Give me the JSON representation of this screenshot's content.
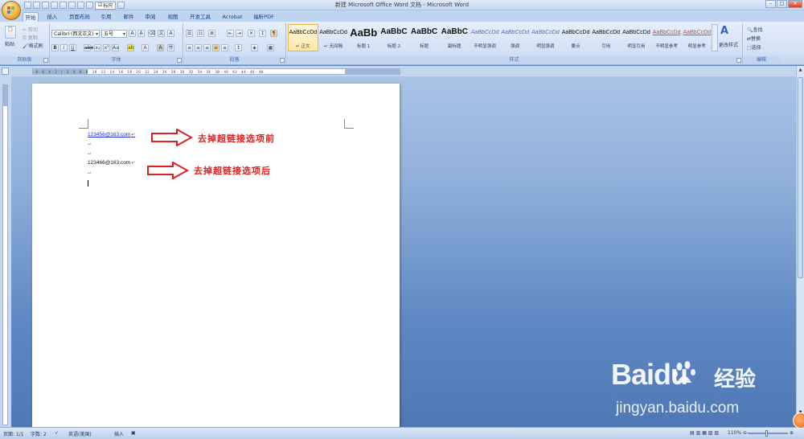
{
  "window": {
    "title": "新建 Microsoft Office Word 文档 - Microsoft Word",
    "ruler_toggle_label": "标尺"
  },
  "tabs": [
    "开始",
    "插入",
    "页面布局",
    "引用",
    "邮件",
    "审阅",
    "视图",
    "开发工具",
    "Acrobat",
    "福昕PDF"
  ],
  "clipboard": {
    "paste": "粘贴",
    "cut": "剪切",
    "copy": "复制",
    "format_painter": "格式刷",
    "group": "剪贴板"
  },
  "font": {
    "family": "Calibri (西文正文)",
    "size": "五号",
    "group": "字体"
  },
  "paragraph": {
    "group": "段落"
  },
  "styles": {
    "group": "样式",
    "items": [
      {
        "sample": "AaBbCcDd",
        "name": "↵ 正文"
      },
      {
        "sample": "AaBbCcDd",
        "name": "↵ 无间隔"
      },
      {
        "sample": "AaBb",
        "name": "标题 1"
      },
      {
        "sample": "AaBbC",
        "name": "标题 2"
      },
      {
        "sample": "AaBbC",
        "name": "标题"
      },
      {
        "sample": "AaBbC",
        "name": "副标题"
      },
      {
        "sample": "AaBbCcDd",
        "name": "不明显强调"
      },
      {
        "sample": "AaBbCcDd",
        "name": "强调"
      },
      {
        "sample": "AaBbCcDd",
        "name": "明显强调"
      },
      {
        "sample": "AaBbCcDd",
        "name": "要点"
      },
      {
        "sample": "AaBbCcDd",
        "name": "引用"
      },
      {
        "sample": "AaBbCcDd",
        "name": "明显引用"
      },
      {
        "sample": "AaBbCcDd",
        "name": "不明显参考"
      },
      {
        "sample": "AaBbCcDd",
        "name": "明显参考"
      }
    ],
    "change_styles": "更改样式"
  },
  "editing": {
    "find": "查找",
    "replace": "替换",
    "select": "选择",
    "group": "编辑"
  },
  "document": {
    "line1_link": "123456@163.com",
    "line2_plain": "123466@163.com",
    "annotation_before": "去掉超链接选项前",
    "annotation_after": "去掉超链接选项后"
  },
  "status": {
    "page": "页面: 1/1",
    "words": "字数: 2",
    "language": "英语(美国)",
    "mode": "插入",
    "zoom": "110%"
  },
  "watermark": {
    "brand": "Baidu",
    "cn": "经验",
    "url": "jingyan.baidu.com"
  },
  "colors": {
    "annotation": "#e02020",
    "link": "#1b2bd4"
  }
}
